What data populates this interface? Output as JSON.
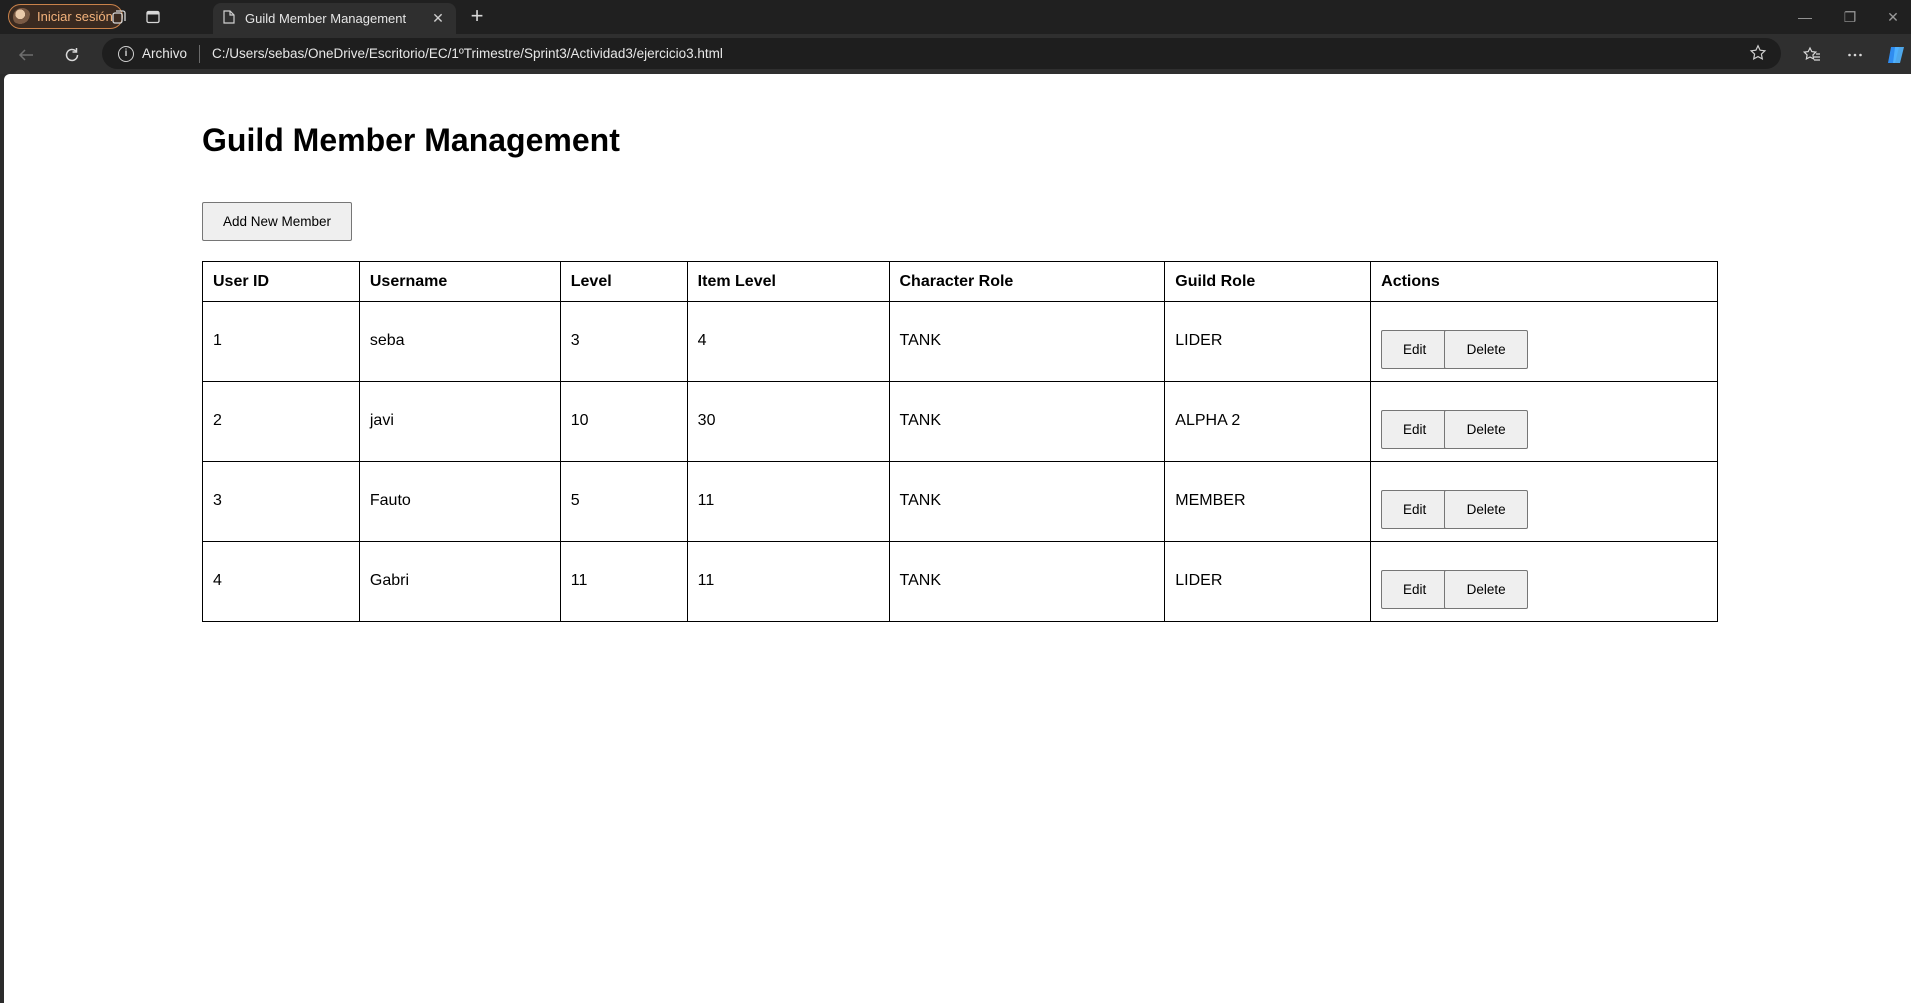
{
  "browser": {
    "profile_label": "Iniciar sesión",
    "tab_title": "Guild Member Management",
    "address_scheme": "Archivo",
    "address_url": "C:/Users/sebas/OneDrive/Escritorio/EC/1ºTrimestre/Sprint3/Actividad3/ejercicio3.html"
  },
  "page": {
    "heading": "Guild Member Management",
    "add_button": "Add New Member",
    "columns": [
      "User ID",
      "Username",
      "Level",
      "Item Level",
      "Character Role",
      "Guild Role",
      "Actions"
    ],
    "rows": [
      {
        "id": "1",
        "username": "seba",
        "level": "3",
        "item_level": "4",
        "character_role": "TANK",
        "guild_role": "LIDER"
      },
      {
        "id": "2",
        "username": "javi",
        "level": "10",
        "item_level": "30",
        "character_role": "TANK",
        "guild_role": "ALPHA 2"
      },
      {
        "id": "3",
        "username": "Fauto",
        "level": "5",
        "item_level": "11",
        "character_role": "TANK",
        "guild_role": "MEMBER"
      },
      {
        "id": "4",
        "username": "Gabri",
        "level": "11",
        "item_level": "11",
        "character_role": "TANK",
        "guild_role": "LIDER"
      }
    ],
    "edit_label": "Edit",
    "delete_label": "Delete"
  }
}
